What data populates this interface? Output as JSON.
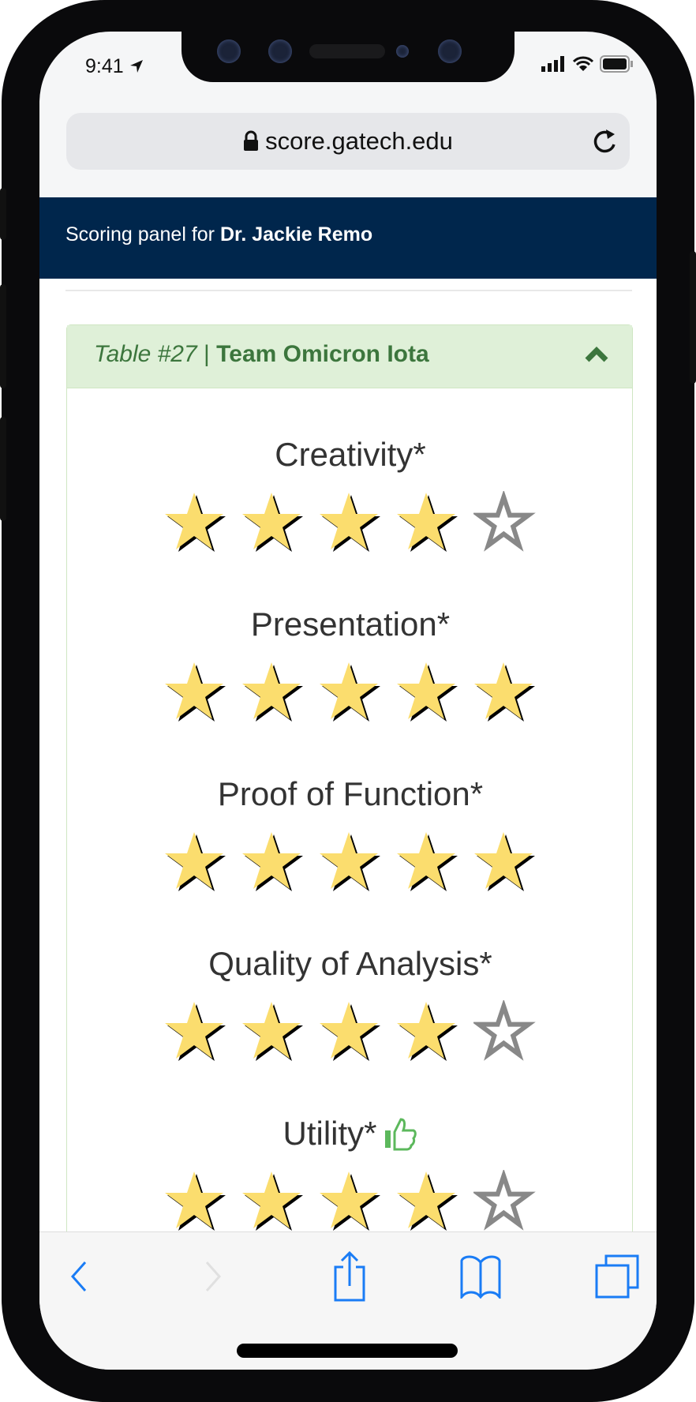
{
  "status_bar": {
    "time": "9:41"
  },
  "browser": {
    "url": "score.gatech.edu"
  },
  "header": {
    "prefix": "Scoring panel for ",
    "judge": "Dr. Jackie Remo"
  },
  "card": {
    "table": "Table #27",
    "separator": " | ",
    "team": "Team Omicron Iota"
  },
  "criteria": [
    {
      "label": "Creativity*",
      "rating": 4,
      "max": 5,
      "thumb": false
    },
    {
      "label": "Presentation*",
      "rating": 5,
      "max": 5,
      "thumb": false
    },
    {
      "label": "Proof of Function*",
      "rating": 5,
      "max": 5,
      "thumb": false
    },
    {
      "label": "Quality of Analysis*",
      "rating": 4,
      "max": 5,
      "thumb": false
    },
    {
      "label": "Utility*",
      "rating": 4,
      "max": 5,
      "thumb": true
    }
  ],
  "colors": {
    "navy": "#00264c",
    "green": "#3c763d",
    "star": "#fbdd6e",
    "ios_blue": "#1a7cf5"
  }
}
